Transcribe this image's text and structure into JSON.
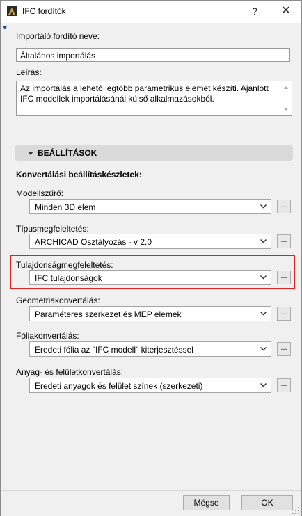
{
  "window": {
    "title": "IFC fordítók",
    "help_glyph": "?",
    "close_glyph": "✕"
  },
  "translator_name": {
    "label": "Importáló fordító neve:",
    "value": "Általános importálás"
  },
  "description": {
    "label": "Leírás:",
    "value": "Az importálás a lehető legtöbb parametrikus elemet készíti. Ajánlott IFC modellek importálásánál külső alkalmazásokból."
  },
  "settings": {
    "header": "BEÁLLÍTÁSOK",
    "presets_label": "Konvertálási beállításkészletek:",
    "rows": [
      {
        "label": "Modellszűrő:",
        "value": "Minden 3D elem"
      },
      {
        "label": "Típusmegfeleltetés:",
        "value": "ARCHICAD Osztályozás - v 2.0"
      },
      {
        "label": "Tulajdonságmegfeleltetés:",
        "value": "IFC tulajdonságok"
      },
      {
        "label": "Geometriakonvertálás:",
        "value": "Paraméteres szerkezet és MEP elemek"
      },
      {
        "label": "Fóliakonvertálás:",
        "value": "Eredeti fólia az \"IFC modell\" kiterjesztéssel"
      },
      {
        "label": "Anyag- és felületkonvertálás:",
        "value": "Eredeti anyagok és felület színek (szerkezeti)"
      }
    ],
    "more_button": "..."
  },
  "footer": {
    "cancel_label": "Mégse",
    "ok_label": "OK"
  },
  "colors": {
    "highlight": "#e02020",
    "section_header_bg": "#dadada"
  }
}
